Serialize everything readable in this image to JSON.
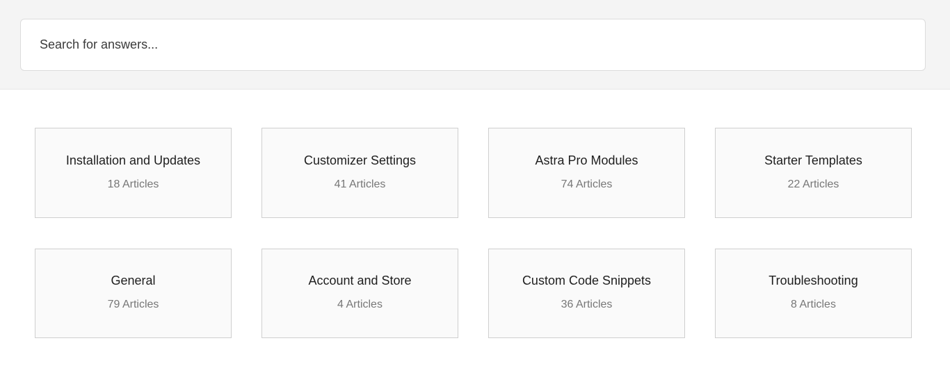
{
  "search": {
    "placeholder": "Search for answers..."
  },
  "categories": [
    {
      "title": "Installation and Updates",
      "count": "18 Articles"
    },
    {
      "title": "Customizer Settings",
      "count": "41 Articles"
    },
    {
      "title": "Astra Pro Modules",
      "count": "74 Articles"
    },
    {
      "title": "Starter Templates",
      "count": "22 Articles"
    },
    {
      "title": "General",
      "count": "79 Articles"
    },
    {
      "title": "Account and Store",
      "count": "4 Articles"
    },
    {
      "title": "Custom Code Snippets",
      "count": "36 Articles"
    },
    {
      "title": "Troubleshooting",
      "count": "8 Articles"
    }
  ]
}
